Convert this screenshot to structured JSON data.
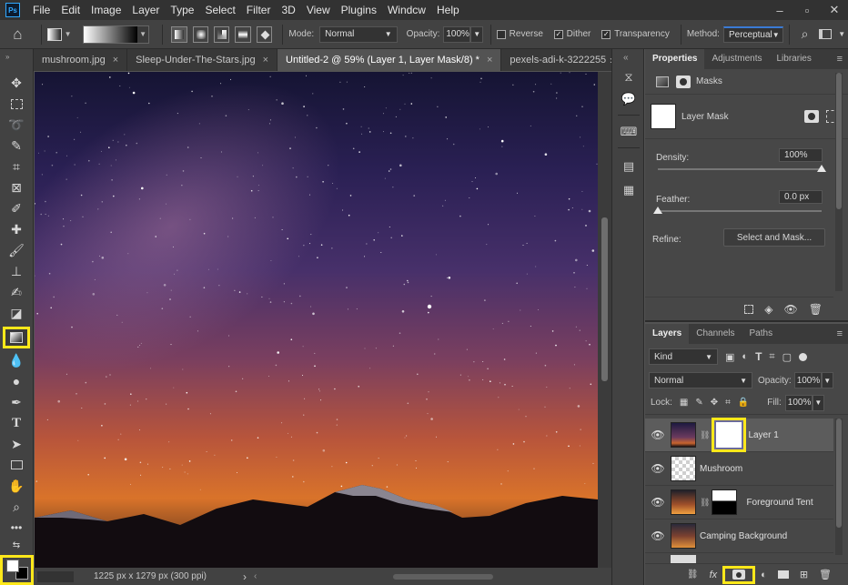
{
  "menubar": {
    "logo": "Ps",
    "items": [
      "File",
      "Edit",
      "Image",
      "Layer",
      "Type",
      "Select",
      "Filter",
      "3D",
      "View",
      "Plugins",
      "Windcw",
      "Help"
    ]
  },
  "options": {
    "mode_label": "Mode:",
    "mode_value": "Normal",
    "opacity_label": "Opacity:",
    "opacity_value": "100%",
    "reverse_label": "Reverse",
    "dither_label": "Dither",
    "transparency_label": "Transparency",
    "method_label": "Method:",
    "method_value": "Perceptual"
  },
  "tabs": [
    {
      "label": "mushroom.jpg"
    },
    {
      "label": "Sleep-Under-The-Stars.jpg"
    },
    {
      "label": "Untitled-2 @ 59% (Layer 1, Layer Mask/8) *"
    },
    {
      "label": "pexels-adi-k-3222255"
    }
  ],
  "tab_overflow": "»",
  "status": {
    "doc_info": "1225 px x 1279 px (300 ppi)",
    "arrow": "›"
  },
  "properties": {
    "tabs": [
      "Properties",
      "Adjustments",
      "Libraries"
    ],
    "masks_label": "Masks",
    "layer_mask_label": "Layer Mask",
    "density_label": "Density:",
    "density_value": "100%",
    "density_level": 1.0,
    "feather_label": "Feather:",
    "feather_value": "0.0 px",
    "feather_level": 0.0,
    "refine_label": "Refine:",
    "select_mask_button": "Select and Mask..."
  },
  "layers_panel": {
    "tabs": [
      "Layers",
      "Channels",
      "Paths"
    ],
    "kind_value": "Kind",
    "blend_value": "Normal",
    "opacity_label": "Opacity:",
    "opacity_value": "100%",
    "lock_label": "Lock:",
    "fill_label": "Fill:",
    "fill_value": "100%",
    "layers": [
      {
        "name": "Layer 1"
      },
      {
        "name": "Mushroom"
      },
      {
        "name": "Foreground Tent"
      },
      {
        "name": "Camping Background"
      }
    ],
    "footer_icons": [
      "link-icon",
      "fx-icon",
      "add-mask-icon",
      "adjustment-icon",
      "group-icon",
      "new-layer-icon",
      "trash-icon"
    ],
    "fx_label": "fx"
  },
  "colors": {
    "highlight": "#ffe81a",
    "accent": "#31a8ff"
  }
}
